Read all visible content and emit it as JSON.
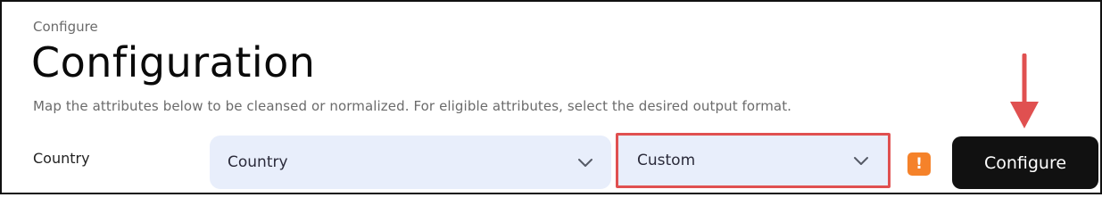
{
  "header": {
    "breadcrumb": "Configure",
    "title": "Configuration",
    "description": "Map the attributes below to be cleansed or normalized. For eligible attributes, select the desired output format."
  },
  "row": {
    "label": "Country",
    "attribute_select": {
      "value": "Country",
      "icon": "chevron-down-icon"
    },
    "format_select": {
      "value": "Custom",
      "icon": "chevron-down-icon"
    },
    "warning_badge": {
      "symbol": "!",
      "color": "#f5822a"
    }
  },
  "actions": {
    "configure_label": "Configure"
  },
  "colors": {
    "accent": "#111111",
    "select_bg": "#e8eefb",
    "annotation": "#e05050"
  }
}
